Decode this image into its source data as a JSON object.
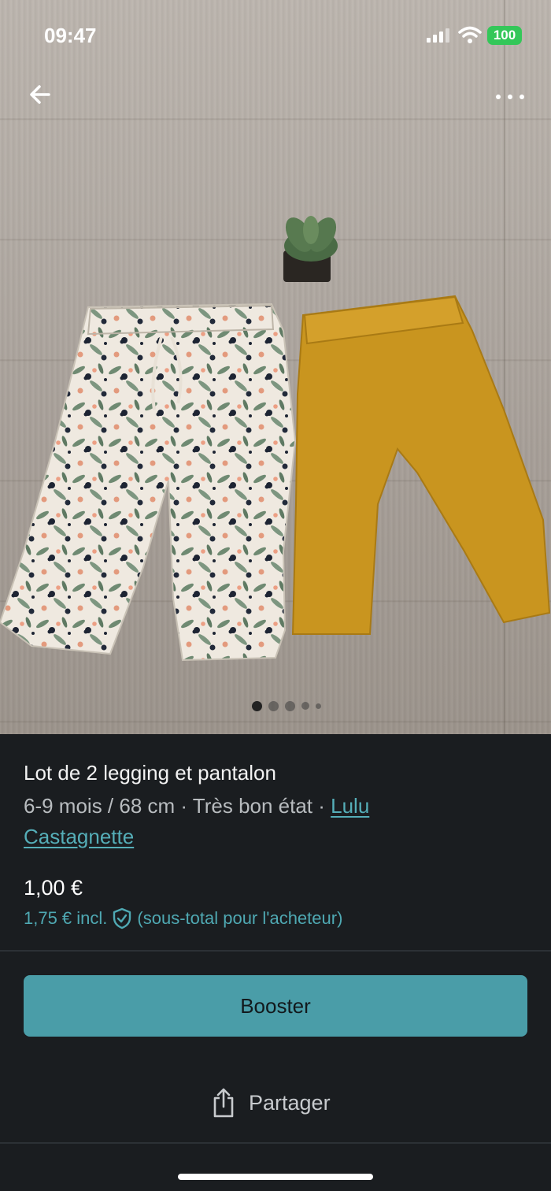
{
  "status_bar": {
    "time": "09:47",
    "battery": "100",
    "battery_color": "#34c759"
  },
  "nav": {
    "back_icon": "arrow-left-icon",
    "more_icon": "more-horizontal-icon"
  },
  "photo": {
    "subject": "Two baby trousers: floral pattern and mustard legging, with small succulent",
    "carousel": {
      "total": 5,
      "current": 1
    }
  },
  "listing": {
    "title": "Lot de 2 legging et pantalon",
    "meta": "6-9 mois / 68 cm · Très bon état · ",
    "brand": "Lulu Castagnette",
    "price": "1,00 €",
    "price_incl": "1,75 € incl.",
    "price_note": "(sous-total pour l'acheteur)",
    "protection_icon": "shield-check-icon"
  },
  "actions": {
    "booster_label": "Booster",
    "share_label": "Partager",
    "share_icon": "share-icon"
  },
  "colors": {
    "accent": "#4a9da8",
    "link": "#55aeb8",
    "background": "#1a1d20"
  }
}
